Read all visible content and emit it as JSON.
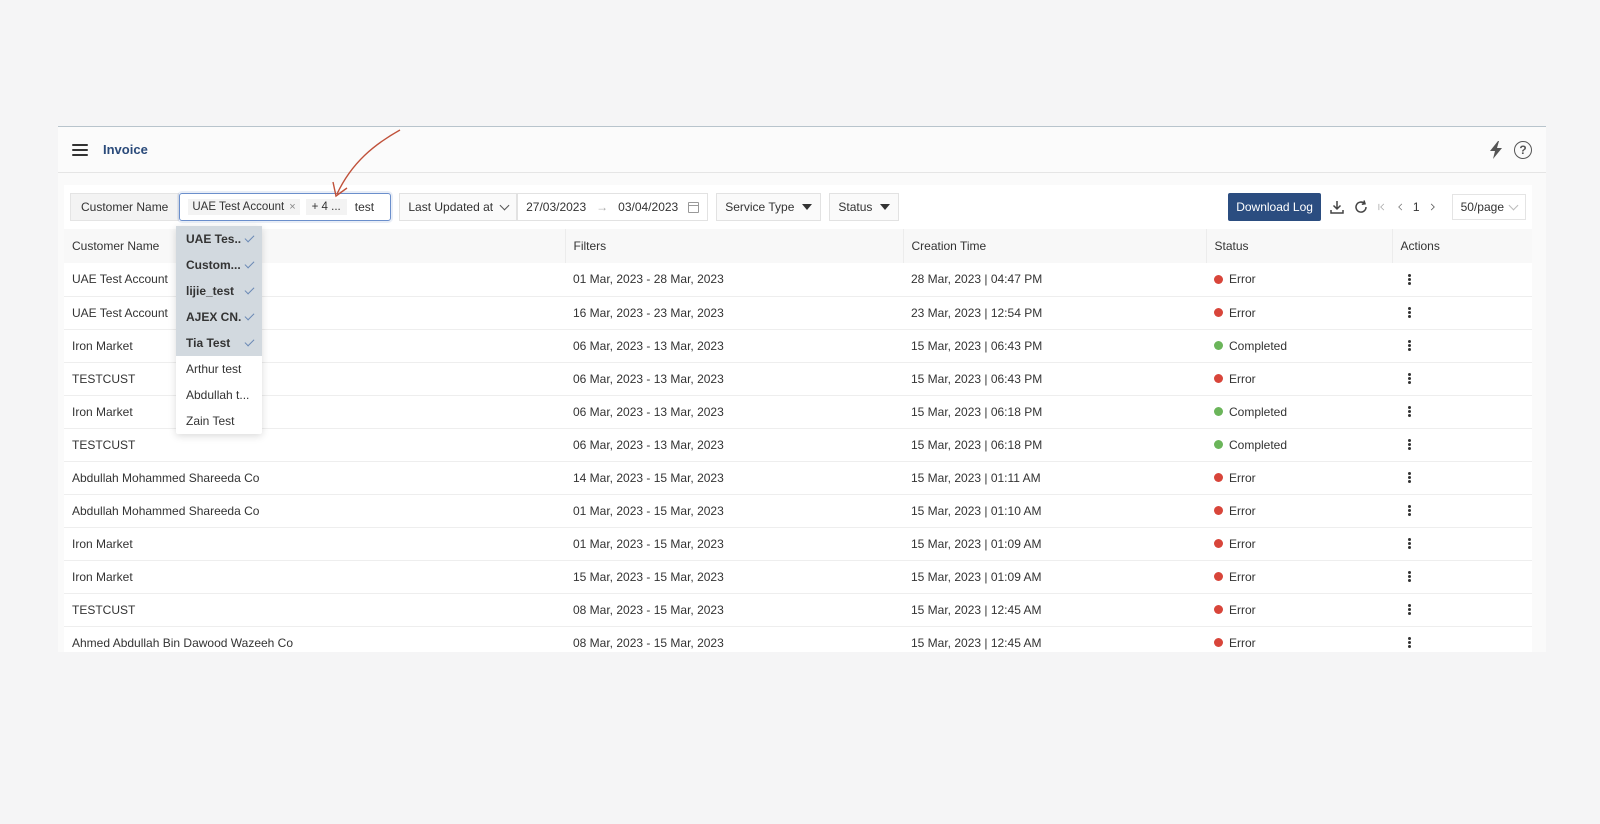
{
  "app": {
    "title": "Invoice"
  },
  "filters": {
    "customer_label": "Customer Name",
    "selected_tag": "UAE Test Account",
    "more_tag": "+ 4 ...",
    "search_value": "test",
    "date_field": "Last Updated at",
    "date_from": "27/03/2023",
    "date_to": "03/04/2023",
    "service_type": "Service Type",
    "status": "Status"
  },
  "toolbar": {
    "download_log": "Download Log",
    "current_page": "1",
    "page_size": "50/page"
  },
  "table": {
    "columns": [
      "Customer Name",
      "Filters",
      "Creation Time",
      "Status",
      "Actions"
    ],
    "rows": [
      {
        "customer": "UAE Test Account",
        "filters": "01 Mar, 2023 - 28 Mar, 2023",
        "created": "28 Mar, 2023 | 04:47 PM",
        "status": "Error"
      },
      {
        "customer": "UAE Test Account",
        "filters": "16 Mar, 2023 - 23 Mar, 2023",
        "created": "23 Mar, 2023 | 12:54 PM",
        "status": "Error"
      },
      {
        "customer": "Iron Market",
        "filters": "06 Mar, 2023 - 13 Mar, 2023",
        "created": "15 Mar, 2023 | 06:43 PM",
        "status": "Completed"
      },
      {
        "customer": "TESTCUST",
        "filters": "06 Mar, 2023 - 13 Mar, 2023",
        "created": "15 Mar, 2023 | 06:43 PM",
        "status": "Error"
      },
      {
        "customer": "Iron Market",
        "filters": "06 Mar, 2023 - 13 Mar, 2023",
        "created": "15 Mar, 2023 | 06:18 PM",
        "status": "Completed"
      },
      {
        "customer": "TESTCUST",
        "filters": "06 Mar, 2023 - 13 Mar, 2023",
        "created": "15 Mar, 2023 | 06:18 PM",
        "status": "Completed"
      },
      {
        "customer": "Abdullah Mohammed Shareeda Co",
        "filters": "14 Mar, 2023 - 15 Mar, 2023",
        "created": "15 Mar, 2023 | 01:11 AM",
        "status": "Error"
      },
      {
        "customer": "Abdullah Mohammed Shareeda Co",
        "filters": "01 Mar, 2023 - 15 Mar, 2023",
        "created": "15 Mar, 2023 | 01:10 AM",
        "status": "Error"
      },
      {
        "customer": "Iron Market",
        "filters": "01 Mar, 2023 - 15 Mar, 2023",
        "created": "15 Mar, 2023 | 01:09 AM",
        "status": "Error"
      },
      {
        "customer": "Iron Market",
        "filters": "15 Mar, 2023 - 15 Mar, 2023",
        "created": "15 Mar, 2023 | 01:09 AM",
        "status": "Error"
      },
      {
        "customer": "TESTCUST",
        "filters": "08 Mar, 2023 - 15 Mar, 2023",
        "created": "15 Mar, 2023 | 12:45 AM",
        "status": "Error"
      },
      {
        "customer": "Ahmed Abdullah Bin Dawood Wazeeh Co",
        "filters": "08 Mar, 2023 - 15 Mar, 2023",
        "created": "15 Mar, 2023 | 12:45 AM",
        "status": "Error"
      }
    ]
  },
  "dropdown": {
    "items": [
      {
        "label": "UAE Tes...",
        "selected": true
      },
      {
        "label": "Custom...",
        "selected": true
      },
      {
        "label": "lijie_test",
        "selected": true
      },
      {
        "label": "AJEX CN...",
        "selected": true
      },
      {
        "label": "Tia Test",
        "selected": true
      },
      {
        "label": "Arthur test",
        "selected": false
      },
      {
        "label": "Abdullah t...",
        "selected": false
      },
      {
        "label": "Zain Test",
        "selected": false
      }
    ]
  },
  "colors": {
    "error": "#d8453a",
    "completed": "#6bb55a",
    "primary": "#2b4d80",
    "annotation": "#c0513a"
  },
  "icons": [
    "menu-icon",
    "bolt-icon",
    "help-icon",
    "download-icon",
    "refresh-icon",
    "first-page-icon",
    "prev-page-icon",
    "next-page-icon",
    "calendar-icon",
    "check-icon",
    "kebab-icon"
  ]
}
